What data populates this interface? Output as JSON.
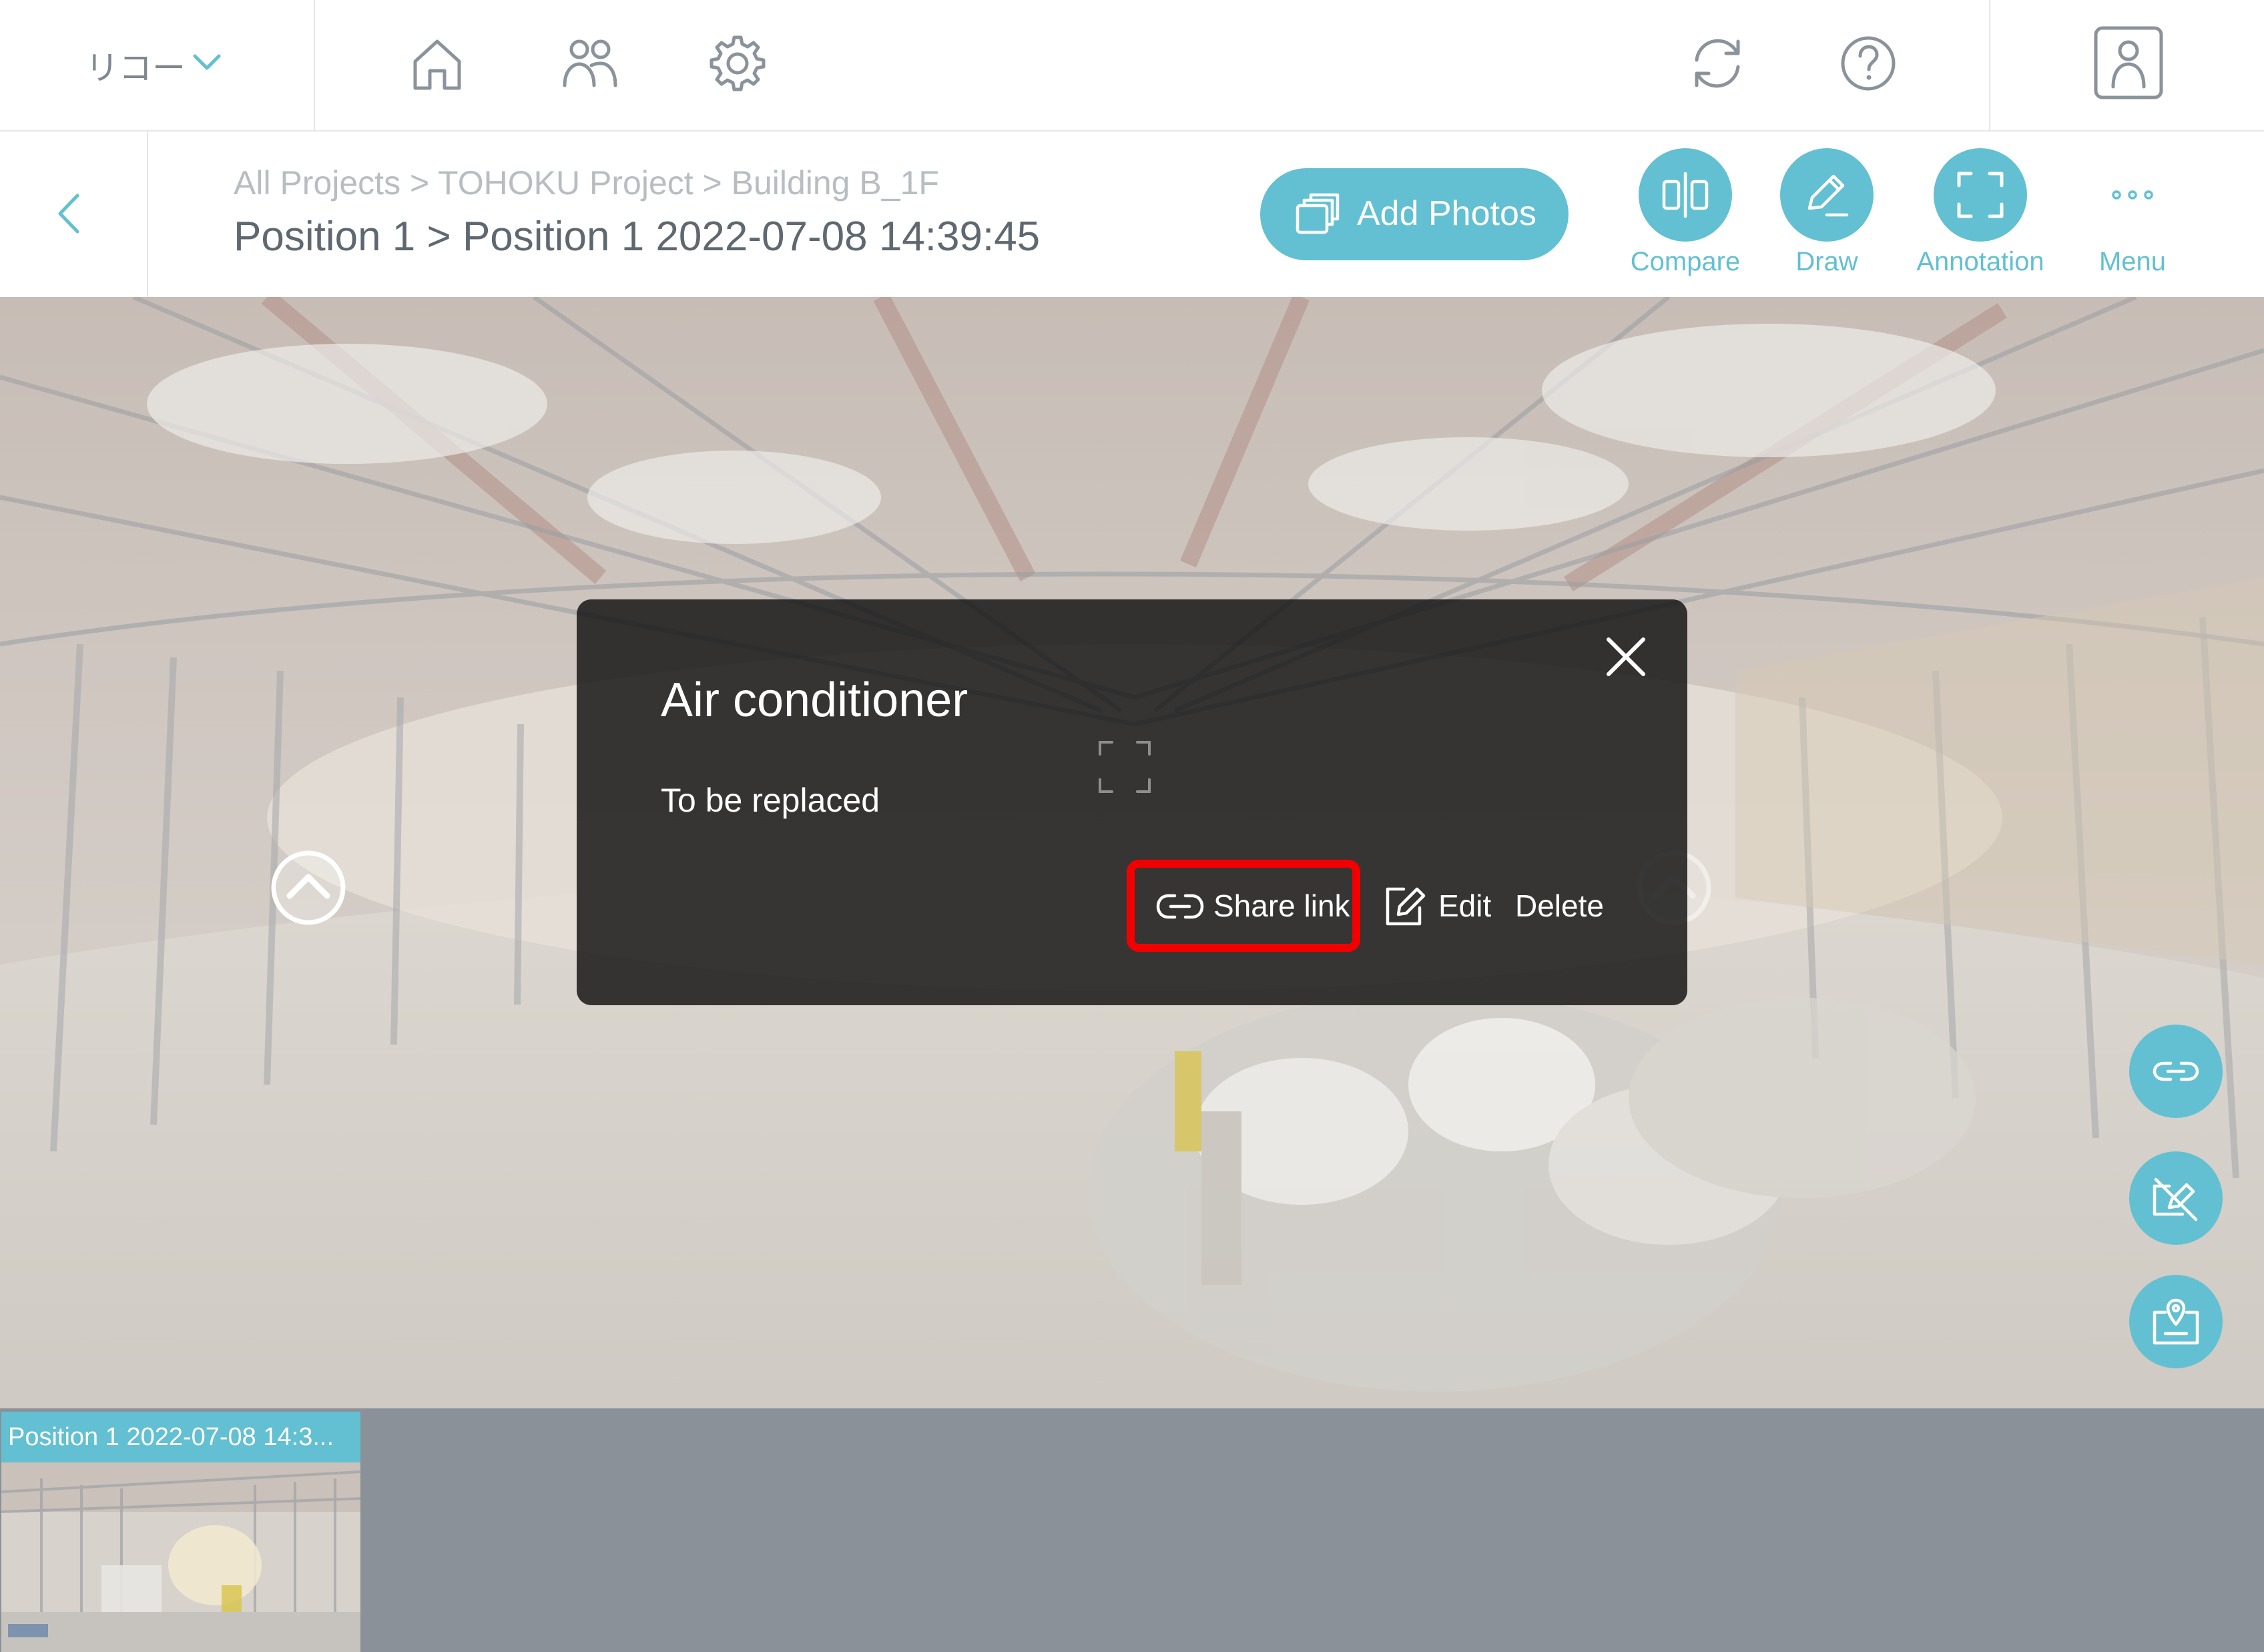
{
  "topbar": {
    "org_name": "リコー"
  },
  "header": {
    "breadcrumb_path": "All Projects > TOHOKU Project > Building B_1F",
    "current_position": "Position 1 > Position 1 2022-07-08 14:39:45",
    "add_photos_label": "Add Photos",
    "tools": {
      "compare": "Compare",
      "draw": "Draw",
      "annotation": "Annotation",
      "menu": "Menu"
    }
  },
  "annotation_popup": {
    "title": "Air conditioner",
    "description": "To be replaced",
    "share_link_label": "Share link",
    "edit_label": "Edit",
    "delete_label": "Delete"
  },
  "thumbnails": [
    {
      "label": "Position 1 2022-07-08 14:3..."
    }
  ],
  "colors": {
    "accent": "#62c0d2",
    "highlight": "#f20000",
    "strip_background": "#8a9199"
  }
}
